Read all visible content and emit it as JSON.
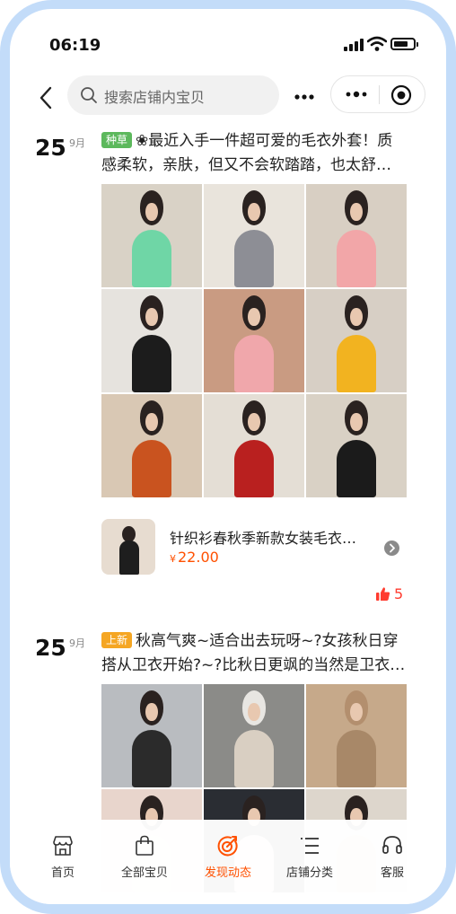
{
  "status_bar": {
    "time": "06:19"
  },
  "nav": {
    "search_placeholder": "搜索店铺内宝贝"
  },
  "posts": [
    {
      "day": "25",
      "month": "9月",
      "tag": "种草",
      "tag_color": "#5cb85c",
      "text": "❀最近入手一件超可爱的毛衣外套！质感柔软，亲肤，但又不会软踏踏，也太舒…",
      "product": {
        "name": "针织衫春秋季新款女装毛衣…",
        "currency": "¥",
        "price": "22.00"
      },
      "likes": "5"
    },
    {
      "day": "25",
      "month": "9月",
      "tag": "上新",
      "tag_color": "#f5a623",
      "text": "秋高气爽~适合出去玩呀~?女孩秋日穿搭从卫衣开始?~?比秋日更飒的当然是卫衣…"
    }
  ],
  "tabbar": {
    "items": [
      {
        "label": "首页",
        "icon": "shop-icon"
      },
      {
        "label": "全部宝贝",
        "icon": "bag-icon"
      },
      {
        "label": "发现动态",
        "icon": "discover-icon",
        "active": true
      },
      {
        "label": "店铺分类",
        "icon": "list-icon"
      },
      {
        "label": "客服",
        "icon": "headset-icon"
      }
    ]
  },
  "colors": {
    "accent": "#ff5000",
    "frame": "#c3dcf9",
    "like": "#ff3b2f"
  }
}
